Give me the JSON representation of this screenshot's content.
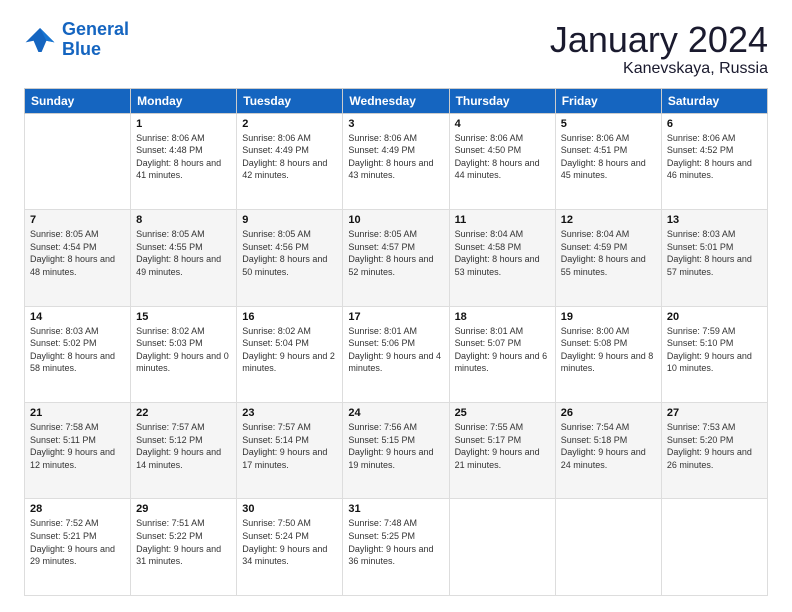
{
  "logo": {
    "line1": "General",
    "line2": "Blue"
  },
  "title": "January 2024",
  "subtitle": "Kanevskaya, Russia",
  "days_header": [
    "Sunday",
    "Monday",
    "Tuesday",
    "Wednesday",
    "Thursday",
    "Friday",
    "Saturday"
  ],
  "weeks": [
    [
      {
        "day": "",
        "sunrise": "",
        "sunset": "",
        "daylight": ""
      },
      {
        "day": "1",
        "sunrise": "Sunrise: 8:06 AM",
        "sunset": "Sunset: 4:48 PM",
        "daylight": "Daylight: 8 hours and 41 minutes."
      },
      {
        "day": "2",
        "sunrise": "Sunrise: 8:06 AM",
        "sunset": "Sunset: 4:49 PM",
        "daylight": "Daylight: 8 hours and 42 minutes."
      },
      {
        "day": "3",
        "sunrise": "Sunrise: 8:06 AM",
        "sunset": "Sunset: 4:49 PM",
        "daylight": "Daylight: 8 hours and 43 minutes."
      },
      {
        "day": "4",
        "sunrise": "Sunrise: 8:06 AM",
        "sunset": "Sunset: 4:50 PM",
        "daylight": "Daylight: 8 hours and 44 minutes."
      },
      {
        "day": "5",
        "sunrise": "Sunrise: 8:06 AM",
        "sunset": "Sunset: 4:51 PM",
        "daylight": "Daylight: 8 hours and 45 minutes."
      },
      {
        "day": "6",
        "sunrise": "Sunrise: 8:06 AM",
        "sunset": "Sunset: 4:52 PM",
        "daylight": "Daylight: 8 hours and 46 minutes."
      }
    ],
    [
      {
        "day": "7",
        "sunrise": "Sunrise: 8:05 AM",
        "sunset": "Sunset: 4:54 PM",
        "daylight": "Daylight: 8 hours and 48 minutes."
      },
      {
        "day": "8",
        "sunrise": "Sunrise: 8:05 AM",
        "sunset": "Sunset: 4:55 PM",
        "daylight": "Daylight: 8 hours and 49 minutes."
      },
      {
        "day": "9",
        "sunrise": "Sunrise: 8:05 AM",
        "sunset": "Sunset: 4:56 PM",
        "daylight": "Daylight: 8 hours and 50 minutes."
      },
      {
        "day": "10",
        "sunrise": "Sunrise: 8:05 AM",
        "sunset": "Sunset: 4:57 PM",
        "daylight": "Daylight: 8 hours and 52 minutes."
      },
      {
        "day": "11",
        "sunrise": "Sunrise: 8:04 AM",
        "sunset": "Sunset: 4:58 PM",
        "daylight": "Daylight: 8 hours and 53 minutes."
      },
      {
        "day": "12",
        "sunrise": "Sunrise: 8:04 AM",
        "sunset": "Sunset: 4:59 PM",
        "daylight": "Daylight: 8 hours and 55 minutes."
      },
      {
        "day": "13",
        "sunrise": "Sunrise: 8:03 AM",
        "sunset": "Sunset: 5:01 PM",
        "daylight": "Daylight: 8 hours and 57 minutes."
      }
    ],
    [
      {
        "day": "14",
        "sunrise": "Sunrise: 8:03 AM",
        "sunset": "Sunset: 5:02 PM",
        "daylight": "Daylight: 8 hours and 58 minutes."
      },
      {
        "day": "15",
        "sunrise": "Sunrise: 8:02 AM",
        "sunset": "Sunset: 5:03 PM",
        "daylight": "Daylight: 9 hours and 0 minutes."
      },
      {
        "day": "16",
        "sunrise": "Sunrise: 8:02 AM",
        "sunset": "Sunset: 5:04 PM",
        "daylight": "Daylight: 9 hours and 2 minutes."
      },
      {
        "day": "17",
        "sunrise": "Sunrise: 8:01 AM",
        "sunset": "Sunset: 5:06 PM",
        "daylight": "Daylight: 9 hours and 4 minutes."
      },
      {
        "day": "18",
        "sunrise": "Sunrise: 8:01 AM",
        "sunset": "Sunset: 5:07 PM",
        "daylight": "Daylight: 9 hours and 6 minutes."
      },
      {
        "day": "19",
        "sunrise": "Sunrise: 8:00 AM",
        "sunset": "Sunset: 5:08 PM",
        "daylight": "Daylight: 9 hours and 8 minutes."
      },
      {
        "day": "20",
        "sunrise": "Sunrise: 7:59 AM",
        "sunset": "Sunset: 5:10 PM",
        "daylight": "Daylight: 9 hours and 10 minutes."
      }
    ],
    [
      {
        "day": "21",
        "sunrise": "Sunrise: 7:58 AM",
        "sunset": "Sunset: 5:11 PM",
        "daylight": "Daylight: 9 hours and 12 minutes."
      },
      {
        "day": "22",
        "sunrise": "Sunrise: 7:57 AM",
        "sunset": "Sunset: 5:12 PM",
        "daylight": "Daylight: 9 hours and 14 minutes."
      },
      {
        "day": "23",
        "sunrise": "Sunrise: 7:57 AM",
        "sunset": "Sunset: 5:14 PM",
        "daylight": "Daylight: 9 hours and 17 minutes."
      },
      {
        "day": "24",
        "sunrise": "Sunrise: 7:56 AM",
        "sunset": "Sunset: 5:15 PM",
        "daylight": "Daylight: 9 hours and 19 minutes."
      },
      {
        "day": "25",
        "sunrise": "Sunrise: 7:55 AM",
        "sunset": "Sunset: 5:17 PM",
        "daylight": "Daylight: 9 hours and 21 minutes."
      },
      {
        "day": "26",
        "sunrise": "Sunrise: 7:54 AM",
        "sunset": "Sunset: 5:18 PM",
        "daylight": "Daylight: 9 hours and 24 minutes."
      },
      {
        "day": "27",
        "sunrise": "Sunrise: 7:53 AM",
        "sunset": "Sunset: 5:20 PM",
        "daylight": "Daylight: 9 hours and 26 minutes."
      }
    ],
    [
      {
        "day": "28",
        "sunrise": "Sunrise: 7:52 AM",
        "sunset": "Sunset: 5:21 PM",
        "daylight": "Daylight: 9 hours and 29 minutes."
      },
      {
        "day": "29",
        "sunrise": "Sunrise: 7:51 AM",
        "sunset": "Sunset: 5:22 PM",
        "daylight": "Daylight: 9 hours and 31 minutes."
      },
      {
        "day": "30",
        "sunrise": "Sunrise: 7:50 AM",
        "sunset": "Sunset: 5:24 PM",
        "daylight": "Daylight: 9 hours and 34 minutes."
      },
      {
        "day": "31",
        "sunrise": "Sunrise: 7:48 AM",
        "sunset": "Sunset: 5:25 PM",
        "daylight": "Daylight: 9 hours and 36 minutes."
      },
      {
        "day": "",
        "sunrise": "",
        "sunset": "",
        "daylight": ""
      },
      {
        "day": "",
        "sunrise": "",
        "sunset": "",
        "daylight": ""
      },
      {
        "day": "",
        "sunrise": "",
        "sunset": "",
        "daylight": ""
      }
    ]
  ]
}
